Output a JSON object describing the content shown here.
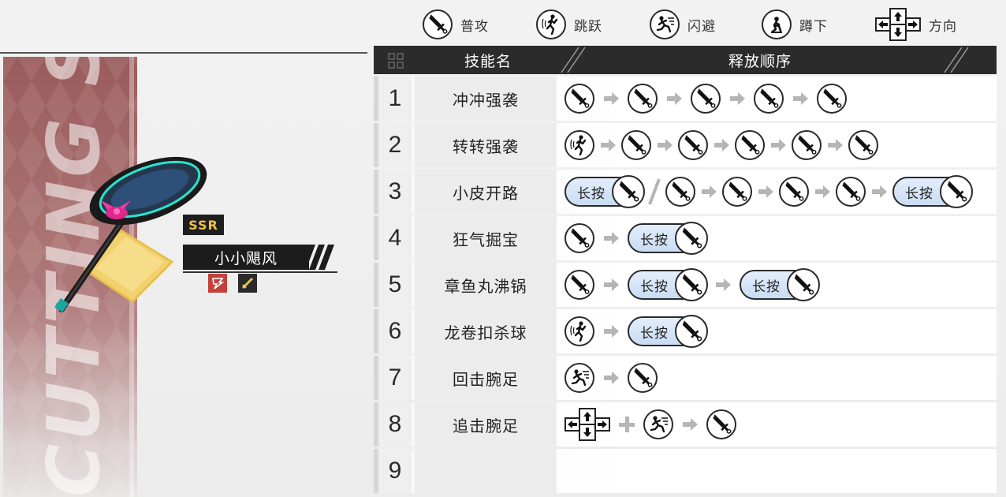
{
  "legend": {
    "items": [
      {
        "icon": "sword-icon",
        "label": "普攻"
      },
      {
        "icon": "jump-icon",
        "label": "跳跃"
      },
      {
        "icon": "dodge-icon",
        "label": "闪避"
      },
      {
        "icon": "crouch-icon",
        "label": "蹲下"
      },
      {
        "icon": "dpad-icon",
        "label": "方向"
      }
    ]
  },
  "weapon": {
    "banner_text": "CUTTING SKILLS",
    "rarity": "SSR",
    "name": "小小飓风"
  },
  "table": {
    "headers": {
      "name": "技能名",
      "sequence": "释放顺序"
    },
    "hold_label": "长按",
    "rows": [
      {
        "num": "1",
        "name": "冲冲强袭",
        "seq": [
          "atk",
          "arrow",
          "atk",
          "arrow",
          "atk",
          "arrow",
          "atk",
          "arrow",
          "atk"
        ]
      },
      {
        "num": "2",
        "name": "转转强袭",
        "seq": [
          "jump",
          "arrow",
          "atk",
          "arrow",
          "atk",
          "arrow",
          "atk",
          "arrow",
          "atk",
          "arrow",
          "atk"
        ]
      },
      {
        "num": "3",
        "name": "小皮开路",
        "seq": [
          "hold",
          "slash",
          "atk",
          "arrow",
          "atk",
          "arrow",
          "atk",
          "arrow",
          "atk",
          "arrow",
          "hold"
        ]
      },
      {
        "num": "4",
        "name": "狂气掘宝",
        "seq": [
          "atk",
          "arrow",
          "hold"
        ]
      },
      {
        "num": "5",
        "name": "章鱼丸沸锅",
        "seq": [
          "atk",
          "arrow",
          "hold",
          "arrow",
          "hold"
        ]
      },
      {
        "num": "6",
        "name": "龙卷扣杀球",
        "seq": [
          "jump",
          "arrow",
          "hold"
        ]
      },
      {
        "num": "7",
        "name": "回击腕足",
        "seq": [
          "dodge",
          "arrow",
          "atk"
        ]
      },
      {
        "num": "8",
        "name": "追击腕足",
        "seq": [
          "dpad",
          "plus",
          "dodge",
          "arrow",
          "atk"
        ]
      },
      {
        "num": "9",
        "name": "",
        "seq": []
      }
    ]
  }
}
